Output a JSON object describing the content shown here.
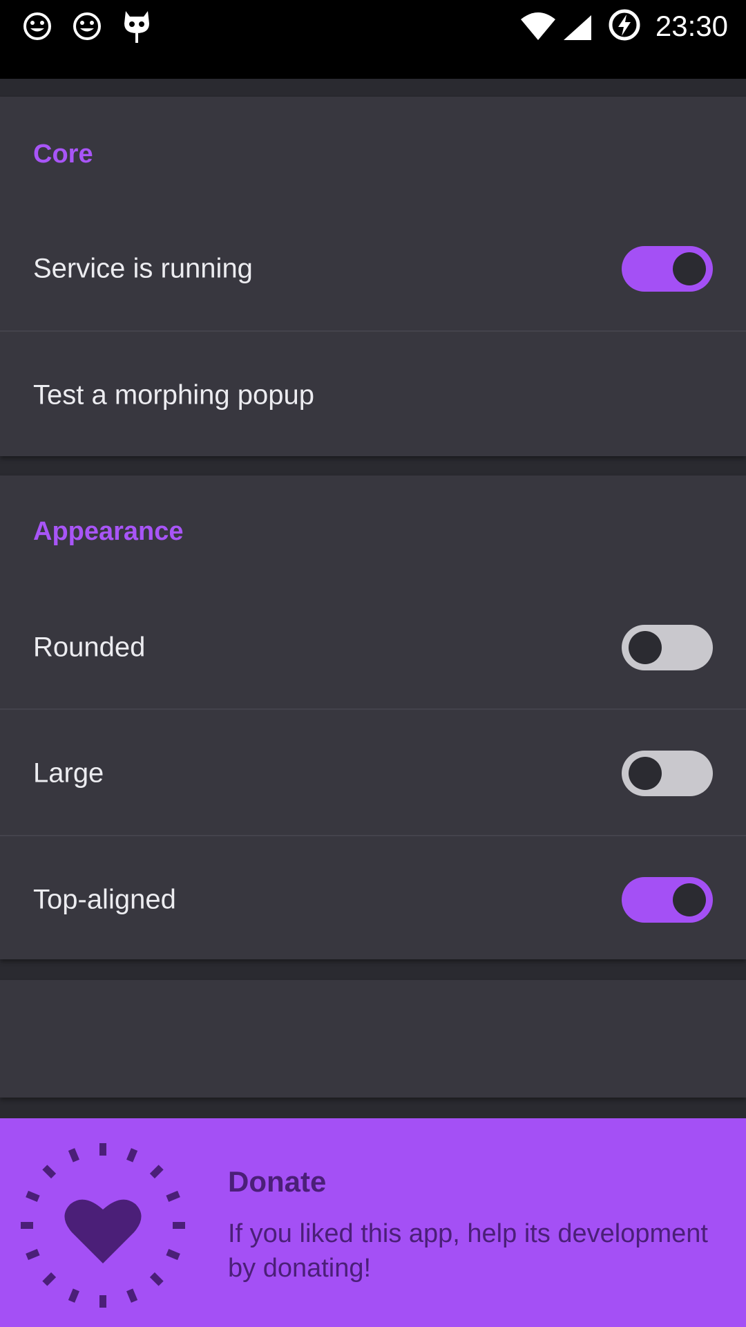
{
  "status_bar": {
    "time": "23:30",
    "icons": [
      "smiley-icon",
      "smiley-icon",
      "cyanogen-mascot-icon",
      "wifi-icon",
      "signal-icon",
      "battery-charging-icon"
    ]
  },
  "sections": {
    "core": {
      "title": "Core",
      "service_running": {
        "label": "Service is running",
        "checked": true
      },
      "test_popup": {
        "label": "Test a morphing popup"
      }
    },
    "appearance": {
      "title": "Appearance",
      "rounded": {
        "label": "Rounded",
        "checked": false
      },
      "large": {
        "label": "Large",
        "checked": false
      },
      "top_aligned": {
        "label": "Top-aligned",
        "checked": true
      }
    }
  },
  "donate": {
    "title": "Donate",
    "text": "If you liked this app, help its development by donating!",
    "icon": "heart-icon"
  },
  "colors": {
    "accent": "#a450f5",
    "background": "#2a2a30",
    "card": "#38373f",
    "donate_text": "#4b1f78"
  }
}
